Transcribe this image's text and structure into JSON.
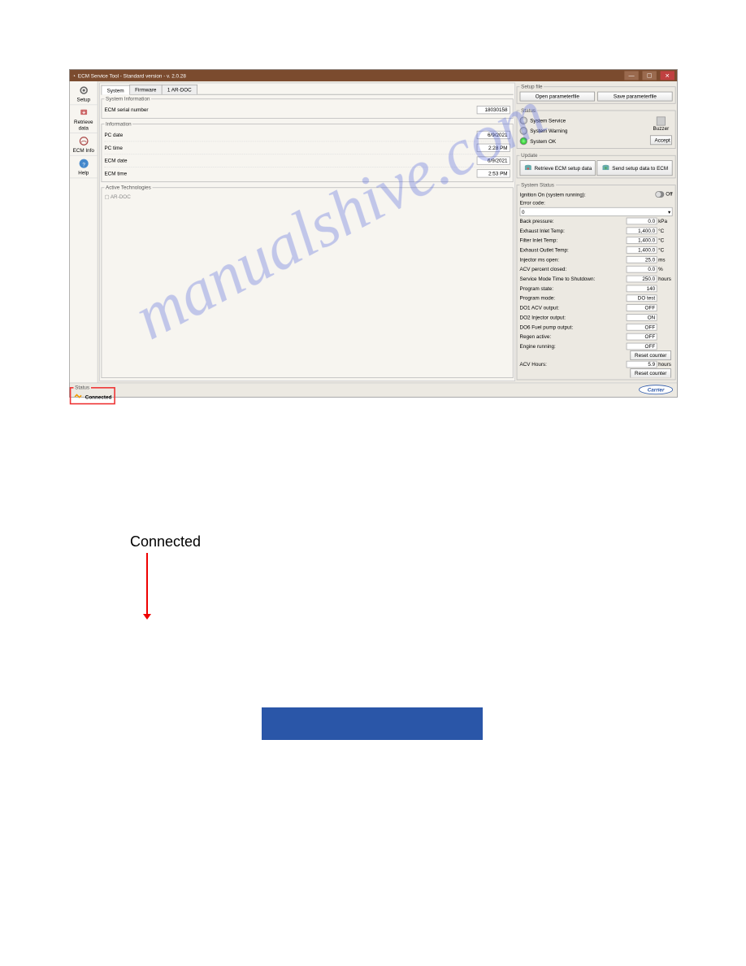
{
  "window": {
    "title": "ECM Service Tool - Standard version - v. 2.0.28"
  },
  "sidebar": {
    "items": [
      {
        "label": "Setup"
      },
      {
        "label": "Retrieve data"
      },
      {
        "label": "ECM Info"
      },
      {
        "label": "Help"
      }
    ]
  },
  "tabs": [
    {
      "label": "System"
    },
    {
      "label": "Firmware"
    },
    {
      "label": "1 AR-DOC"
    }
  ],
  "system_info": {
    "legend": "System Information",
    "ecm_serial_label": "ECM serial number",
    "ecm_serial": "18030158"
  },
  "information": {
    "legend": "Information",
    "pc_date_label": "PC date",
    "pc_date": "6/9/2021",
    "pc_time_label": "PC time",
    "pc_time": "2:28 PM",
    "ecm_date_label": "ECM date",
    "ecm_date": "6/9/2021",
    "ecm_time_label": "ECM time",
    "ecm_time": "2:53 PM"
  },
  "active_tech": {
    "legend": "Active Technologies",
    "item": "AR-DOC"
  },
  "setup_file": {
    "legend": "Setup file",
    "open": "Open parameterfile",
    "save": "Save parameterfile"
  },
  "status_box": {
    "legend": "Status",
    "service": "System Service",
    "warning": "System Warning",
    "ok": "System OK",
    "buzzer": "Buzzer",
    "accept": "Accept"
  },
  "update": {
    "legend": "Update",
    "retrieve": "Retrieve ECM setup data",
    "send": "Send setup data to ECM"
  },
  "system_status": {
    "legend": "System Status",
    "ignition_label": "Ignition On (system running):",
    "ignition_state": "Off",
    "error_code_label": "Error code:",
    "error_code": "0",
    "rows": [
      {
        "label": "Back pressure:",
        "value": "0.0",
        "unit": "kPa"
      },
      {
        "label": "Exhaust Inlet Temp:",
        "value": "1,400.0",
        "unit": "°C"
      },
      {
        "label": "Filter Inlet Temp:",
        "value": "1,400.0",
        "unit": "°C"
      },
      {
        "label": "Exhaust Outlet Temp:",
        "value": "1,400.0",
        "unit": "°C"
      },
      {
        "label": "Injector ms open:",
        "value": "25.0",
        "unit": "ms"
      },
      {
        "label": "ACV percent closed:",
        "value": "0.0",
        "unit": "%"
      },
      {
        "label": "Service Mode Time to Shutdown:",
        "value": "250.0",
        "unit": "hours"
      },
      {
        "label": "Program state:",
        "value": "140",
        "unit": ""
      },
      {
        "label": "Program mode:",
        "value": "DO test",
        "unit": ""
      },
      {
        "label": "DO1 ACV output:",
        "value": "OFF",
        "unit": ""
      },
      {
        "label": "DO2 Injector output:",
        "value": "ON",
        "unit": ""
      },
      {
        "label": "DO6 Fuel pump output:",
        "value": "OFF",
        "unit": ""
      },
      {
        "label": "Regen active:",
        "value": "OFF",
        "unit": ""
      },
      {
        "label": "Engine running:",
        "value": "OFF",
        "unit": ""
      }
    ],
    "reset1": "Reset counter",
    "acv_hours_label": "ACV Hours:",
    "acv_hours": "5.9",
    "acv_hours_unit": "hours",
    "reset2": "Reset counter"
  },
  "footer": {
    "legend": "Status",
    "connected": "Connected",
    "brand": "Carrier"
  },
  "annotation": {
    "connected_label": "Connected"
  }
}
